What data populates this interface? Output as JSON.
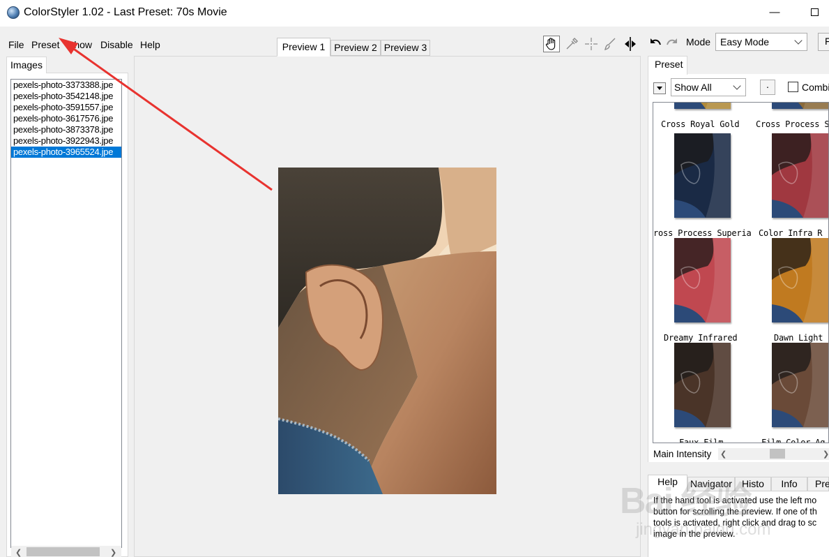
{
  "window": {
    "title": "ColorStyler 1.02 - Last Preset: 70s Movie",
    "minimize_glyph": "—"
  },
  "menu": {
    "file": "File",
    "preset": "Preset",
    "show": "Show",
    "disable": "Disable",
    "help": "Help"
  },
  "left_panel": {
    "tab_label": "Images",
    "files": [
      "pexels-photo-3373388.jpe",
      "pexels-photo-3542148.jpe",
      "pexels-photo-3591557.jpe",
      "pexels-photo-3617576.jpe",
      "pexels-photo-3873378.jpe",
      "pexels-photo-3922943.jpe",
      "pexels-photo-3965524.jpe"
    ],
    "selected_index": 6
  },
  "preview_tabs": [
    "Preview 1",
    "Preview 2",
    "Preview 3"
  ],
  "active_preview_tab": 0,
  "toolbar": {
    "icons": [
      "hand-icon",
      "eyedropper-icon",
      "crosshair-icon",
      "brush-icon",
      "split-view-icon"
    ]
  },
  "right_panel": {
    "mode_label": "Mode",
    "mode_value": "Easy Mode",
    "edge_button_label": "F",
    "preset_tab": "Preset",
    "filter_value": "Show All",
    "dot_button": "·",
    "combine_label": "Combi",
    "presets": [
      {
        "label": "Cross Royal Gold",
        "tint": "#b08a3a"
      },
      {
        "label": "Cross Process Sc",
        "tint": "#8a6a3a"
      },
      {
        "label": "ross Process Superia",
        "tint": "#1a2a45"
      },
      {
        "label": "Color Infra R",
        "tint": "#a03840"
      },
      {
        "label": "Dreamy Infrared",
        "tint": "#c04850"
      },
      {
        "label": "Dawn Light",
        "tint": "#c07a20"
      },
      {
        "label": "Faux Film",
        "tint": "#4a3428"
      },
      {
        "label": "Film Color Ag",
        "tint": "#6a4a38"
      }
    ],
    "intensity_label": "Main Intensity",
    "intensity_value": 0.55,
    "bottom_tabs": [
      "Help",
      "Navigator",
      "Histo",
      "Info",
      "Pre"
    ],
    "active_bottom_tab": 0,
    "help_text": "If the hand tool is activated use the left mo button for scrolling the preview. If one of th tools is activated, right click and drag to sc image in the preview."
  },
  "watermark": {
    "main": "Bai 经验",
    "sub": "jingyan.baidu.com"
  },
  "colors": {
    "selection": "#0078d7",
    "annotation_arrow": "#e8332f"
  }
}
